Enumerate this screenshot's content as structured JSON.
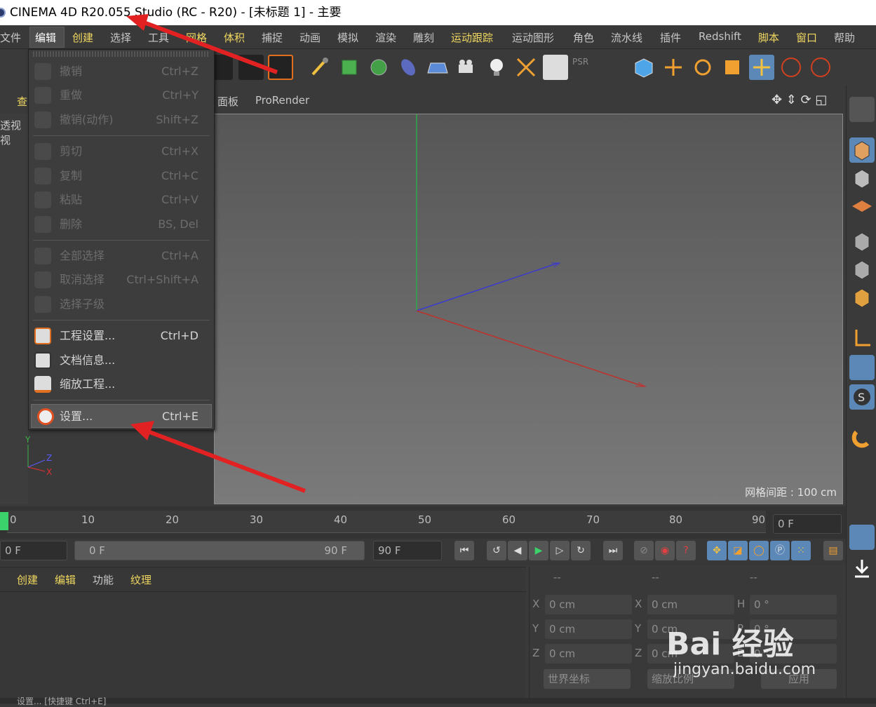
{
  "window": {
    "title": "CINEMA 4D R20.055 Studio (RC - R20) - [未标题 1] - 主要"
  },
  "menubar": {
    "items": [
      {
        "label": "文件",
        "highlight": false
      },
      {
        "label": "编辑",
        "highlight": false
      },
      {
        "label": "创建",
        "highlight": true
      },
      {
        "label": "选择",
        "highlight": false
      },
      {
        "label": "工具",
        "highlight": false
      },
      {
        "label": "网格",
        "highlight": true
      },
      {
        "label": "体积",
        "highlight": true
      },
      {
        "label": "捕捉",
        "highlight": false
      },
      {
        "label": "动画",
        "highlight": false
      },
      {
        "label": "模拟",
        "highlight": false
      },
      {
        "label": "渲染",
        "highlight": false
      },
      {
        "label": "雕刻",
        "highlight": false
      },
      {
        "label": "运动跟踪",
        "highlight": true
      },
      {
        "label": "运动图形",
        "highlight": false
      },
      {
        "label": "角色",
        "highlight": false
      },
      {
        "label": "流水线",
        "highlight": false
      },
      {
        "label": "插件",
        "highlight": false
      },
      {
        "label": "Redshift",
        "highlight": false
      },
      {
        "label": "脚本",
        "highlight": true
      },
      {
        "label": "窗口",
        "highlight": true
      },
      {
        "label": "帮助",
        "highlight": false
      }
    ]
  },
  "edit_menu": {
    "groups": [
      [
        {
          "label": "撤销",
          "shortcut": "Ctrl+Z",
          "enabled": false,
          "icon": "undo-icon"
        },
        {
          "label": "重做",
          "shortcut": "Ctrl+Y",
          "enabled": false,
          "icon": "redo-icon"
        },
        {
          "label": "撤销(动作)",
          "shortcut": "Shift+Z",
          "enabled": false,
          "icon": "undo-action-icon"
        }
      ],
      [
        {
          "label": "剪切",
          "shortcut": "Ctrl+X",
          "enabled": false,
          "icon": "cut-icon"
        },
        {
          "label": "复制",
          "shortcut": "Ctrl+C",
          "enabled": false,
          "icon": "copy-icon"
        },
        {
          "label": "粘贴",
          "shortcut": "Ctrl+V",
          "enabled": false,
          "icon": "paste-icon"
        },
        {
          "label": "删除",
          "shortcut": "BS, Del",
          "enabled": false,
          "icon": "delete-icon"
        }
      ],
      [
        {
          "label": "全部选择",
          "shortcut": "Ctrl+A",
          "enabled": false,
          "icon": "select-all-icon"
        },
        {
          "label": "取消选择",
          "shortcut": "Ctrl+Shift+A",
          "enabled": false,
          "icon": "deselect-icon"
        },
        {
          "label": "选择子级",
          "shortcut": "",
          "enabled": false,
          "icon": "select-children-icon"
        }
      ],
      [
        {
          "label": "工程设置...",
          "shortcut": "Ctrl+D",
          "enabled": true,
          "icon": "project-settings-icon"
        },
        {
          "label": "文档信息...",
          "shortcut": "",
          "enabled": true,
          "icon": "document-info-icon"
        },
        {
          "label": "缩放工程...",
          "shortcut": "",
          "enabled": true,
          "icon": "scale-project-icon"
        }
      ],
      [
        {
          "label": "设置...",
          "shortcut": "Ctrl+E",
          "enabled": true,
          "highlighted": true,
          "icon": "preferences-icon"
        }
      ]
    ]
  },
  "viewport": {
    "tabs_visible": [
      "面板",
      "ProRender"
    ],
    "left_partial": "查",
    "left_partial_2": "透视视",
    "grid_spacing": "网格间距 : 100 cm",
    "axis_labels": [
      "Y",
      "Z",
      "X"
    ]
  },
  "timeline": {
    "ticks": [
      "0",
      "10",
      "20",
      "30",
      "40",
      "50",
      "60",
      "70",
      "80",
      "90"
    ],
    "current_frame": "0 F",
    "start_frame": "0 F",
    "range_start": "0 F",
    "range_end": "90 F",
    "end_frame": "90 F"
  },
  "material_panel": {
    "menu": [
      "创建",
      "编辑",
      "功能",
      "纹理"
    ]
  },
  "coordinates": {
    "headers": [
      "--",
      "--",
      "--"
    ],
    "rows": [
      {
        "axis": "X",
        "pos": "0 cm",
        "axis2": "X",
        "size": "0 cm",
        "rot_label": "H",
        "rot": "0 °"
      },
      {
        "axis": "Y",
        "pos": "0 cm",
        "axis2": "Y",
        "size": "0 cm",
        "rot_label": "P",
        "rot": "0 °"
      },
      {
        "axis": "Z",
        "pos": "0 cm",
        "axis2": "Z",
        "size": "0 cm",
        "rot_label": "B",
        "rot": "0 °"
      }
    ],
    "coord_mode": "世界坐标",
    "scale_mode": "缩放比例",
    "apply": "应用"
  },
  "statusbar": {
    "text": "设置... [快捷键 Ctrl+E]"
  },
  "watermark": {
    "brand": "Bai 经验",
    "url": "jingyan.baidu.com"
  },
  "colors": {
    "accent": "#f0d860",
    "selected_tool": "#5c88b8",
    "arrow": "#e22222",
    "play_green": "#3bd16b"
  }
}
